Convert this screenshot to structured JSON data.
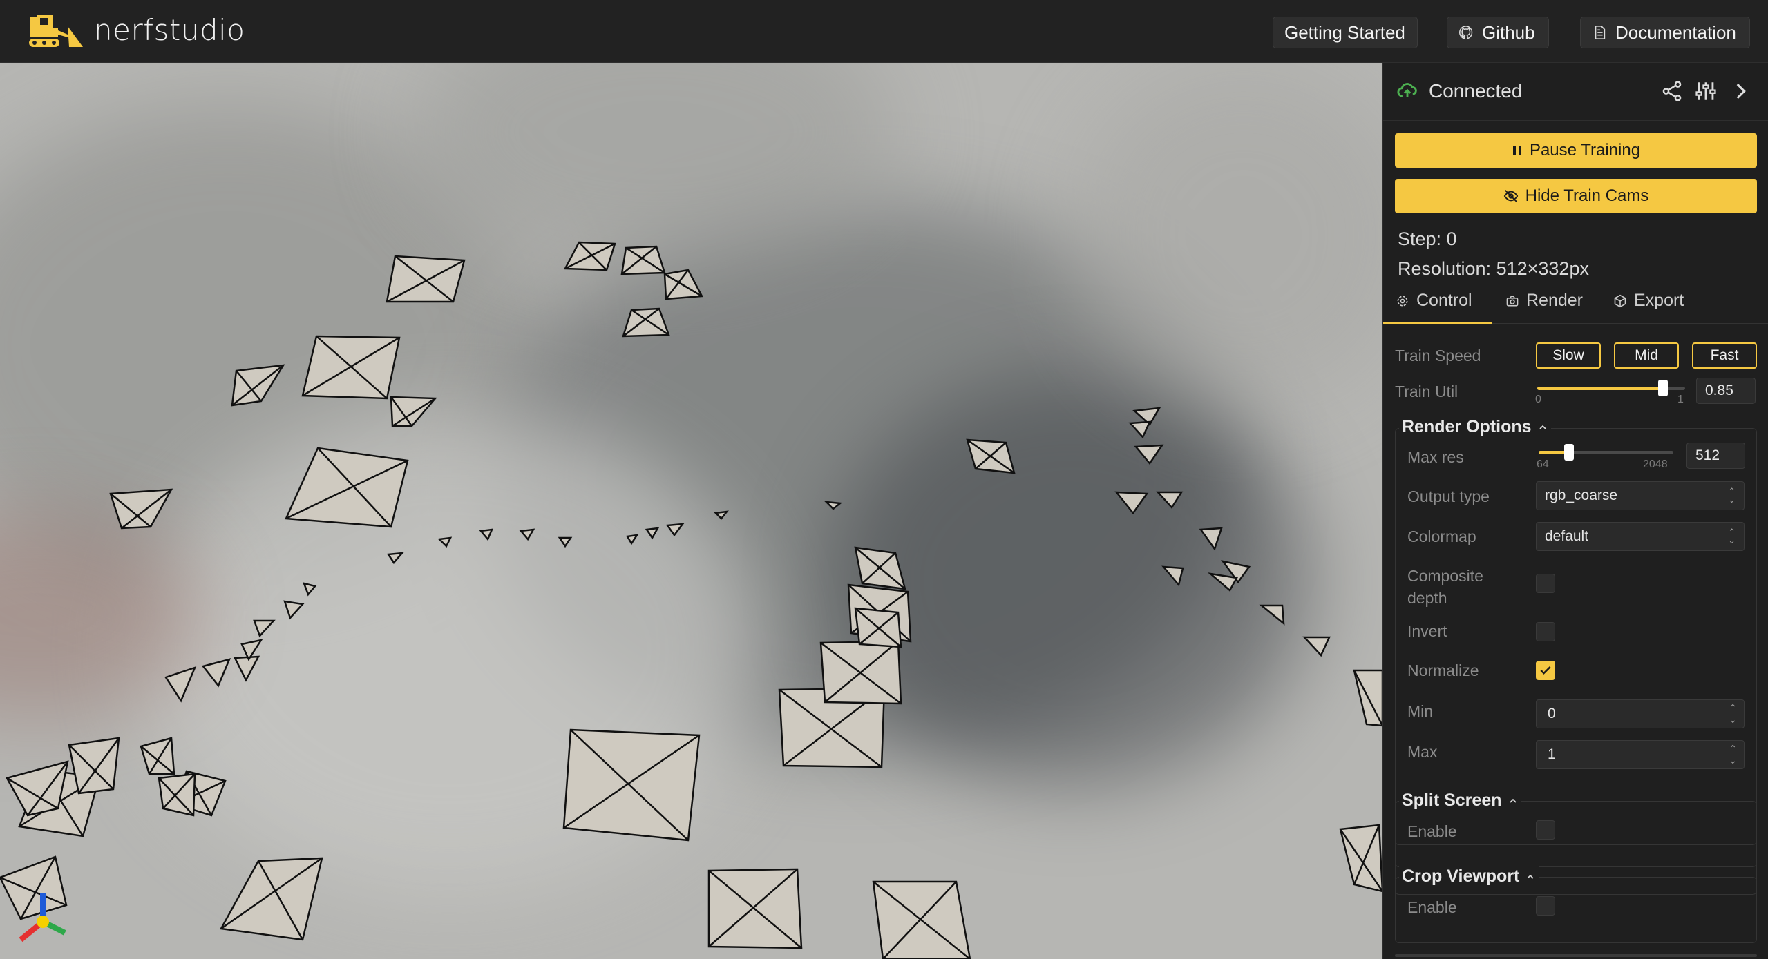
{
  "header": {
    "logo_text": "nerfstudio",
    "buttons": {
      "getting_started": "Getting Started",
      "github": "Github",
      "documentation": "Documentation"
    }
  },
  "panel": {
    "status": "Connected",
    "pause_training": "Pause Training",
    "hide_train_cams": "Hide Train Cams",
    "step": "Step: 0",
    "resolution": "Resolution: 512×332px",
    "tabs": {
      "control": "Control",
      "render": "Render",
      "export": "Export"
    },
    "train_speed": {
      "label": "Train Speed",
      "slow": "Slow",
      "mid": "Mid",
      "fast": "Fast"
    },
    "train_util": {
      "label": "Train Util",
      "min": "0",
      "max": "1",
      "value": "0.85",
      "fraction": 0.85
    },
    "render_options": {
      "title": "Render Options",
      "max_res": {
        "label": "Max res",
        "min": "64",
        "max": "2048",
        "value": "512",
        "fraction": 0.226
      },
      "output_type": {
        "label": "Output type",
        "value": "rgb_coarse"
      },
      "colormap": {
        "label": "Colormap",
        "value": "default"
      },
      "composite_depth": {
        "label_line1": "Composite",
        "label_line2": "depth",
        "checked": false
      },
      "invert": {
        "label": "Invert",
        "checked": false
      },
      "normalize": {
        "label": "Normalize",
        "checked": true
      },
      "min": {
        "label": "Min",
        "value": "0"
      },
      "max": {
        "label": "Max",
        "value": "1"
      }
    },
    "split_screen": {
      "title": "Split Screen",
      "enable_label": "Enable",
      "checked": false
    },
    "crop_viewport": {
      "title": "Crop Viewport",
      "enable_label": "Enable",
      "checked": false
    }
  },
  "colors": {
    "accent": "#f5c842",
    "background": "#1f1f1f",
    "connected": "#4caf50"
  }
}
